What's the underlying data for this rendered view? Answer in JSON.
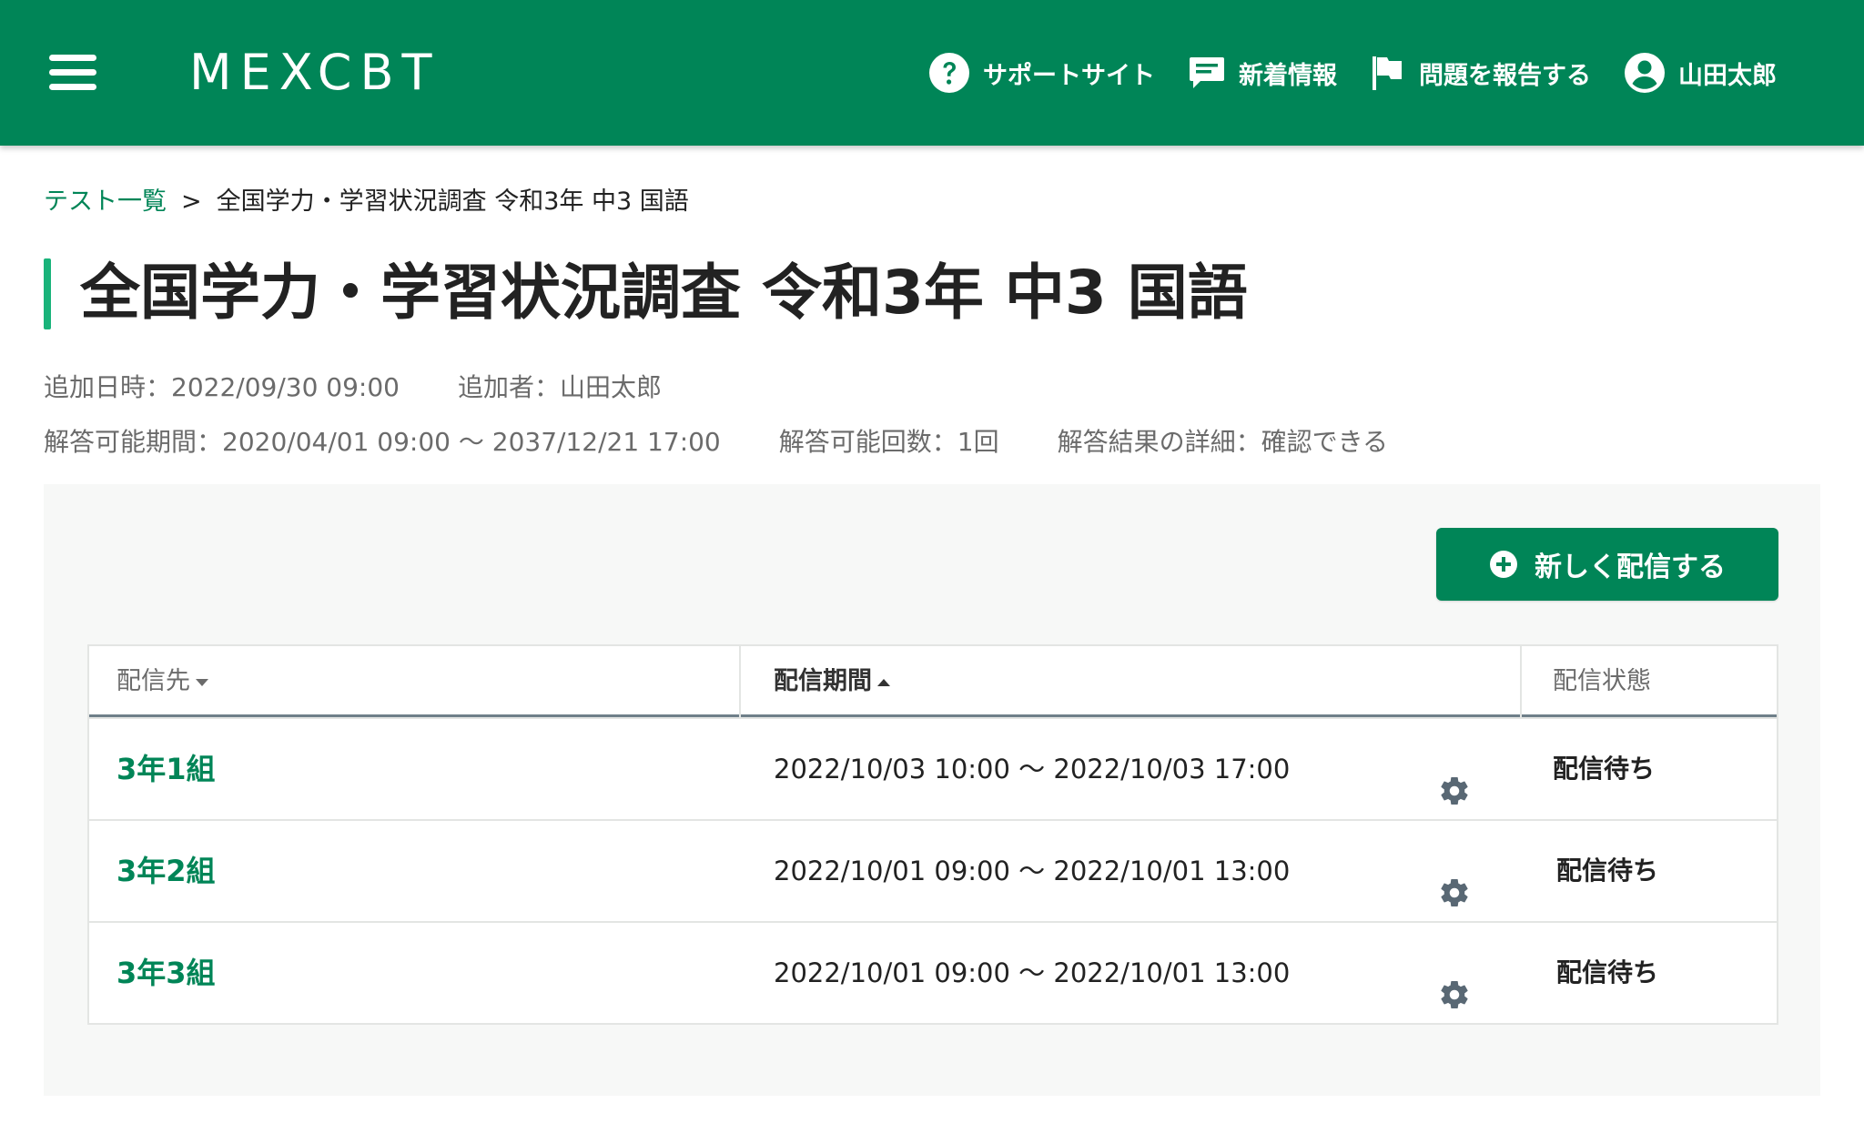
{
  "header": {
    "logo": "MEXCBT",
    "nav": {
      "support": "サポートサイト",
      "news": "新着情報",
      "report": "問題を報告する",
      "user": "山田太郎"
    }
  },
  "breadcrumb": {
    "link": "テスト一覧",
    "separator": ">",
    "current": "全国学力・学習状況調査 令和3年 中3 国語"
  },
  "page_title": "全国学力・学習状況調査 令和3年 中3 国語",
  "meta": {
    "added_at": "追加日時：2022/09/30 09:00",
    "added_by": "追加者：山田太郎",
    "answer_period": "解答可能期間：2020/04/01 09:00 〜 2037/12/21 17:00",
    "answer_count": "解答可能回数：1回",
    "result_detail": "解答結果の詳細：確認できる"
  },
  "new_delivery_button": "新しく配信する",
  "table": {
    "columns": {
      "destination": "配信先",
      "period": "配信期間",
      "status": "配信状態"
    },
    "rows": [
      {
        "class_name": "3年1組",
        "period": "2022/10/03 10:00 〜 2022/10/03 17:00",
        "status": "配信待ち"
      },
      {
        "class_name": "3年2組",
        "period": "2022/10/01 09:00 〜 2022/10/01 13:00",
        "status": "配信待ち"
      },
      {
        "class_name": "3年3組",
        "period": "2022/10/01 09:00 〜 2022/10/01 13:00",
        "status": "配信待ち"
      }
    ]
  },
  "colors": {
    "brand": "#008557",
    "accent_bar": "#19b37a",
    "panel_bg": "#f7f8f7"
  }
}
